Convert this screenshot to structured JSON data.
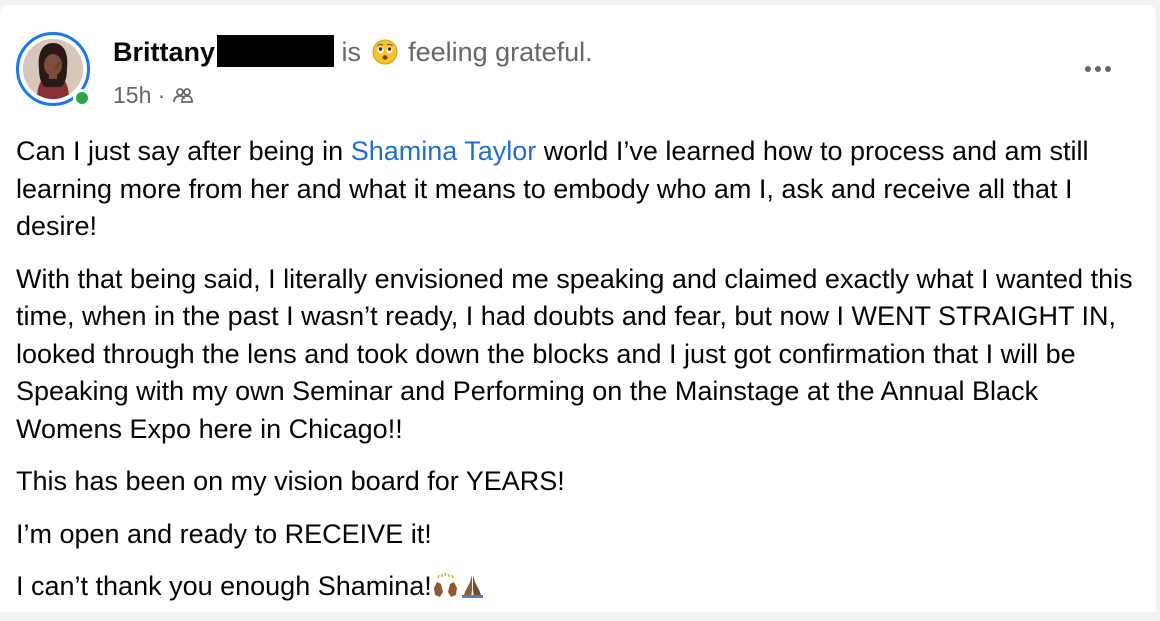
{
  "post": {
    "author": "Brittany",
    "activity_prefix": "is",
    "feeling_emoji": "grateful-face-icon",
    "feeling_text": "feeling grateful.",
    "timestamp": "15h",
    "separator": "·",
    "audience_icon": "friends-audience-icon",
    "menu_icon": "more-options-icon",
    "paragraphs": {
      "p1": {
        "before": "Can I just say after being in ",
        "mention": "Shamina Taylor",
        "after": " world I’ve learned how to process and am still learning more from her and what it means to embody who am I, ask and receive all that I desire!"
      },
      "p2": "With that being said, I literally envisioned me speaking and claimed exactly what I wanted this time, when in the past I wasn’t ready, I had doubts and fear, but now I WENT STRAIGHT IN, looked through the lens and took down the blocks and I just got confirmation that I will be Speaking with my own Seminar and Performing on the Mainstage at the Annual Black Womens Expo here in Chicago!!",
      "p3": "This has been on my vision board for YEARS!",
      "p4": "I’m open and ready to RECEIVE it!",
      "p5": "I can’t thank you enough Shamina!"
    },
    "closing_emojis": [
      "raising-hands-icon",
      "praying-hands-icon"
    ]
  },
  "colors": {
    "link": "#1f6fd1",
    "secondary_text": "#65676b",
    "online": "#31a24c",
    "ring": "#1877f2"
  }
}
